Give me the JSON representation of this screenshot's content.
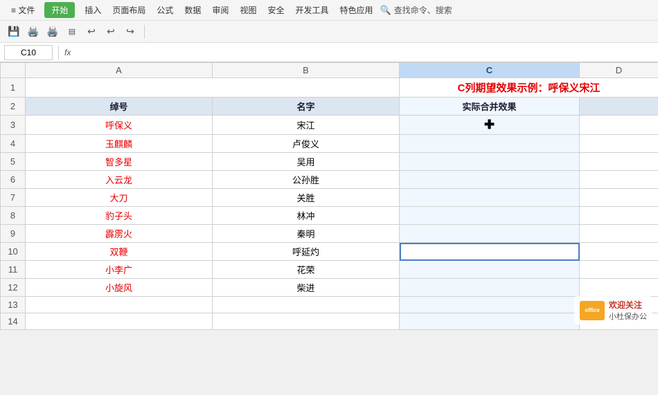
{
  "titlebar": {
    "file_menu": "≡ 文件",
    "menu_items": [
      "插入",
      "页面布局",
      "公式",
      "数据",
      "审阅",
      "视图",
      "安全",
      "开发工具",
      "特色应用"
    ],
    "search_placeholder": "查找命令、搜索",
    "start_button": "开始"
  },
  "toolbar": {
    "icons": [
      "save",
      "undo-save",
      "print",
      "print-preview",
      "undo",
      "undo2",
      "redo"
    ]
  },
  "formula_bar": {
    "cell_ref": "C10",
    "fx_label": "fx"
  },
  "columns": {
    "corner": "",
    "headers": [
      "A",
      "B",
      "C",
      "D"
    ]
  },
  "rows": [
    {
      "num": "1",
      "a": "",
      "b": "",
      "c": "C列期望效果示例：呼保义宋江",
      "d": "",
      "c_span": true,
      "row_type": "title"
    },
    {
      "num": "2",
      "a": "绰号",
      "b": "名字",
      "c": "实际合并效果",
      "d": "",
      "row_type": "header"
    },
    {
      "num": "3",
      "a": "呼保义",
      "b": "宋江",
      "c": "✚",
      "d": "",
      "row_type": "data",
      "c_cursor": true
    },
    {
      "num": "4",
      "a": "玉麒麟",
      "b": "卢俊义",
      "c": "",
      "d": "",
      "row_type": "data"
    },
    {
      "num": "5",
      "a": "智多星",
      "b": "吴用",
      "c": "",
      "d": "",
      "row_type": "data"
    },
    {
      "num": "6",
      "a": "入云龙",
      "b": "公孙胜",
      "c": "",
      "d": "",
      "row_type": "data"
    },
    {
      "num": "7",
      "a": "大刀",
      "b": "关胜",
      "c": "",
      "d": "",
      "row_type": "data"
    },
    {
      "num": "8",
      "a": "豹子头",
      "b": "林冲",
      "c": "",
      "d": "",
      "row_type": "data"
    },
    {
      "num": "9",
      "a": "霹雳火",
      "b": "秦明",
      "c": "",
      "d": "",
      "row_type": "data"
    },
    {
      "num": "10",
      "a": "双鞭",
      "b": "呼延灼",
      "c": "",
      "d": "",
      "row_type": "data",
      "c_selected": true
    },
    {
      "num": "11",
      "a": "小李广",
      "b": "花荣",
      "c": "",
      "d": "",
      "row_type": "data"
    },
    {
      "num": "12",
      "a": "小旋风",
      "b": "柴进",
      "c": "",
      "d": "",
      "row_type": "data"
    },
    {
      "num": "13",
      "a": "",
      "b": "",
      "c": "",
      "d": "",
      "row_type": "data"
    },
    {
      "num": "14",
      "a": "",
      "b": "",
      "c": "",
      "d": "",
      "row_type": "data"
    }
  ],
  "watermark": {
    "icon_text": "office",
    "line1": "欢迎关注",
    "line2": "小杜保办公"
  }
}
